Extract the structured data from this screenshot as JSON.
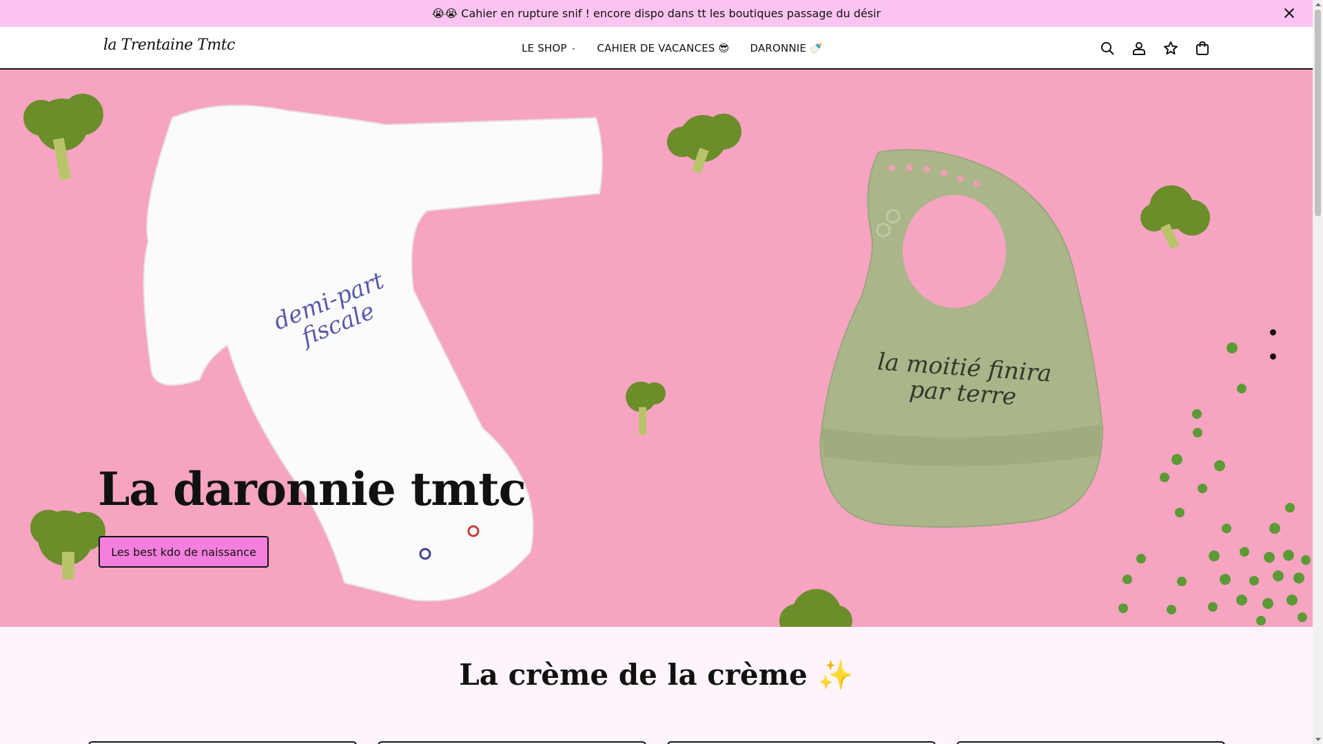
{
  "announcement": {
    "text": "😭😭 Cahier en rupture snif ! encore dispo dans tt les boutiques passage du désir"
  },
  "header": {
    "logo": "la Trentaine Tmtc",
    "nav": [
      {
        "label": "LE SHOP"
      },
      {
        "label": "CAHIER DE VACANCES 😎"
      },
      {
        "label": "DARONNIE 🍼"
      }
    ],
    "icons": [
      "search-icon",
      "account-icon",
      "wishlist-star-icon",
      "cart-bag-icon"
    ]
  },
  "hero": {
    "title": "La daronnie tmtc",
    "cta_label": "Les best kdo de naissance",
    "bodysuit_text_line1": "demi-part",
    "bodysuit_text_line2": "fiscale",
    "bib_text_line1": "la moitié finira",
    "bib_text_line2": "par terre",
    "slide_count": 2,
    "active_slide": 1
  },
  "featured": {
    "title": "La crème de la crème ✨"
  },
  "colors": {
    "announcement_bg": "#fdc4f1",
    "hero_bg": "#f6a4c2",
    "button_bg": "#f57fde",
    "page_bg": "#fef4fb"
  }
}
